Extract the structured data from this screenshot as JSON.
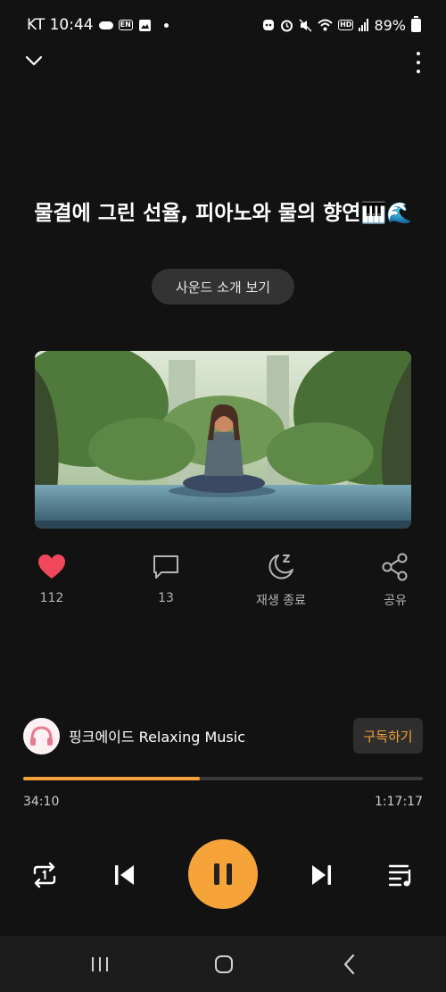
{
  "status_bar": {
    "carrier_time": "KT 10:44",
    "battery": "89%",
    "icons": [
      "cloud-icon",
      "en-badge-icon",
      "image-icon",
      "dot-icon",
      "bixby-icon",
      "alarm-icon",
      "mute-icon",
      "wifi-icon",
      "hd-icon",
      "signal-icon",
      "battery-icon"
    ]
  },
  "header": {
    "collapse_icon": "chevron-down-icon",
    "more_icon": "more-vertical-icon"
  },
  "track": {
    "title": "물결에 그린 선율, 피아노와 물의 향연🎹🌊",
    "intro_button": "사운드 소개 보기"
  },
  "actions": {
    "like_count": "112",
    "comment_count": "13",
    "sleep_timer_label": "재생 종료",
    "share_label": "공유"
  },
  "channel": {
    "name": "핑크에이드 Relaxing Music",
    "subscribe_label": "구독하기"
  },
  "player": {
    "elapsed": "34:10",
    "total": "1:17:17",
    "progress": 0.442,
    "accent_color": "#f5a13a",
    "like_color": "#f0485a"
  }
}
